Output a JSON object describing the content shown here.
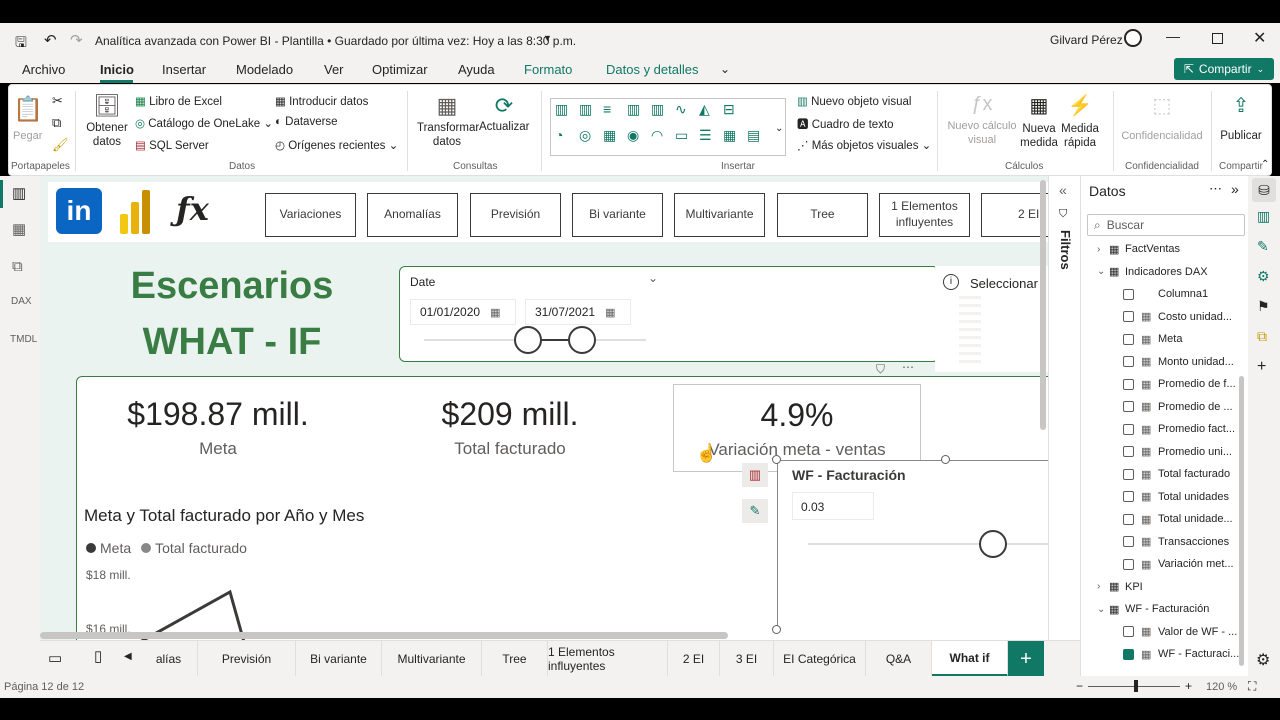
{
  "title": "Analítica avanzada con Power BI - Plantilla • Guardado por última vez: Hoy a las 8:30 p.m.",
  "user": "Gilvard Pérez",
  "menu": [
    "Archivo",
    "Inicio",
    "Insertar",
    "Modelado",
    "Ver",
    "Optimizar",
    "Ayuda",
    "Formato",
    "Datos y detalles"
  ],
  "share": "Compartir",
  "ribbon": {
    "paste": "Pegar",
    "portapapeles": "Portapapeles",
    "get_data": "Obtener datos",
    "excel": "Libro de Excel",
    "onelake": "Catálogo de OneLake",
    "sql": "SQL Server",
    "enter_data": "Introducir datos",
    "dataverse": "Dataverse",
    "recent": "Orígenes recientes",
    "datos": "Datos",
    "transform": "Transformar datos",
    "refresh": "Actualizar",
    "consultas": "Consultas",
    "new_visual": "Nuevo objeto visual",
    "textbox": "Cuadro de texto",
    "more_visuals": "Más objetos visuales",
    "insertar": "Insertar",
    "new_calc": "Nuevo cálculo visual",
    "new_measure": "Nueva medida",
    "quick_measure": "Medida rápida",
    "calculos": "Cálculos",
    "sensitivity": "Confidencialidad",
    "confidencialidad": "Confidencialidad",
    "publish": "Publicar",
    "compartir": "Compartir"
  },
  "nav_buttons": [
    "Variaciones",
    "Anomalías",
    "Previsión",
    "Bi variante",
    "Multivariante",
    "Tree",
    "1 Elementos influyentes",
    "2 EI"
  ],
  "heading": {
    "line1": "Escenarios",
    "line2": "WHAT - IF"
  },
  "slicer": {
    "label": "Date",
    "from": "01/01/2020",
    "to": "31/07/2021",
    "select": "Seleccionar"
  },
  "kpis": [
    {
      "value": "$198.87 mill.",
      "label": "Meta"
    },
    {
      "value": "$209 mill.",
      "label": "Total facturado"
    },
    {
      "value": "4.9%",
      "label": "Variación meta - ventas"
    }
  ],
  "wf": {
    "title": "WF - Facturación",
    "value": "0.03"
  },
  "chart": {
    "title": "Meta y Total facturado por Año y Mes",
    "legend": [
      "Meta",
      "Total facturado"
    ],
    "yticks": [
      "$18 mill.",
      "$16 mill."
    ]
  },
  "filters_label": "Filtros",
  "data_pane": {
    "title": "Datos",
    "search": "Buscar",
    "items": [
      {
        "label": "FactVentas",
        "level": 0,
        "type": "table",
        "expand": "collapsed"
      },
      {
        "label": "Indicadores DAX",
        "level": 0,
        "type": "table",
        "expand": "expanded"
      },
      {
        "label": "Columna1",
        "level": 1,
        "type": "column"
      },
      {
        "label": "Costo unidad...",
        "level": 1,
        "type": "measure"
      },
      {
        "label": "Meta",
        "level": 1,
        "type": "measure"
      },
      {
        "label": "Monto unidad...",
        "level": 1,
        "type": "measure"
      },
      {
        "label": "Promedio de f...",
        "level": 1,
        "type": "measure"
      },
      {
        "label": "Promedio de ...",
        "level": 1,
        "type": "measure"
      },
      {
        "label": "Promedio fact...",
        "level": 1,
        "type": "measure"
      },
      {
        "label": "Promedio uni...",
        "level": 1,
        "type": "measure"
      },
      {
        "label": "Total facturado",
        "level": 1,
        "type": "measure"
      },
      {
        "label": "Total unidades",
        "level": 1,
        "type": "measure"
      },
      {
        "label": "Total unidade...",
        "level": 1,
        "type": "measure"
      },
      {
        "label": "Transacciones",
        "level": 1,
        "type": "measure"
      },
      {
        "label": "Variación met...",
        "level": 1,
        "type": "measure"
      },
      {
        "label": "KPI",
        "level": 0,
        "type": "table",
        "expand": "collapsed"
      },
      {
        "label": "WF - Facturación",
        "level": 0,
        "type": "param",
        "expand": "expanded"
      },
      {
        "label": "Valor de WF - ...",
        "level": 1,
        "type": "measure"
      },
      {
        "label": "WF - Facturaci...",
        "level": 1,
        "type": "measure",
        "checked": true
      }
    ]
  },
  "page_tabs": [
    "alías",
    "Previsión",
    "Bi variante",
    "Multivariante",
    "Tree",
    "1 Elementos influyentes",
    "2 EI",
    "3 EI",
    "EI Categórica",
    "Q&A",
    "What if"
  ],
  "status": {
    "page": "Página 12 de 12",
    "zoom": "120 %"
  }
}
